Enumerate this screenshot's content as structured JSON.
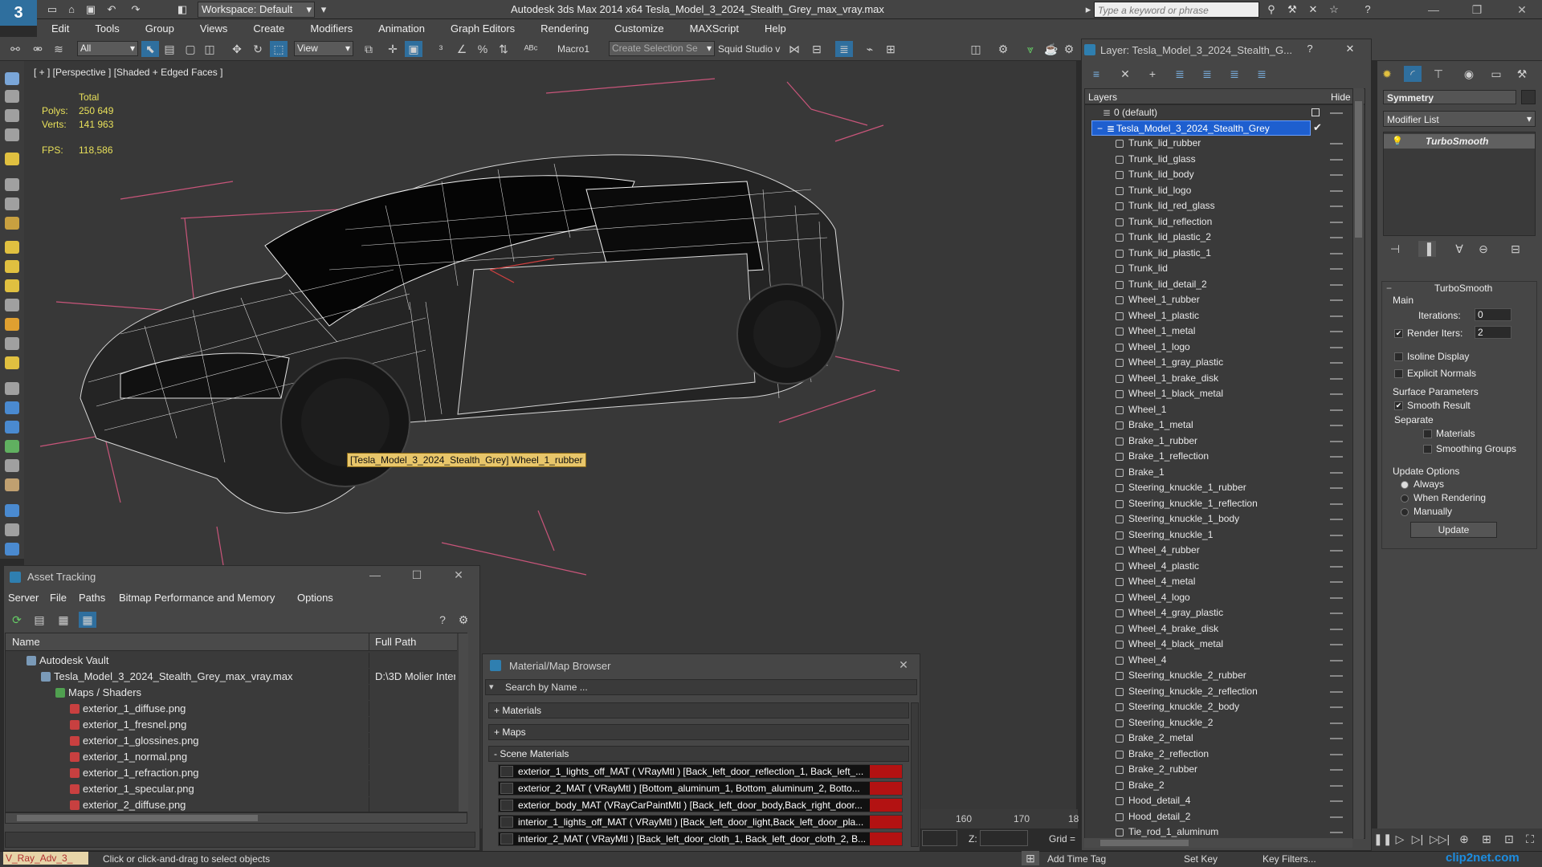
{
  "window": {
    "app_title": "Autodesk 3ds Max  2014 x64     Tesla_Model_3_2024_Stealth_Grey_max_vray.max",
    "workspace": "Workspace: Default",
    "search_placeholder": "Type a keyword or phrase"
  },
  "menu": [
    "Edit",
    "Tools",
    "Group",
    "Views",
    "Create",
    "Modifiers",
    "Animation",
    "Graph Editors",
    "Rendering",
    "Customize",
    "MAXScript",
    "Help"
  ],
  "toolbar": {
    "selection_filter": "All",
    "ref_coord": "View",
    "macro_label": "Macro1",
    "selection_set_placeholder": "Create Selection Se",
    "squid_label": "Squid Studio v"
  },
  "viewport": {
    "label": "[ + ] [Perspective ] [Shaded + Edged Faces ]",
    "stats_total": "Total",
    "polys_label": "Polys:",
    "polys_value": "250 649",
    "verts_label": "Verts:",
    "verts_value": "141 963",
    "fps_label": "FPS:",
    "fps_value": "118,586",
    "tooltip": "[Tesla_Model_3_2024_Stealth_Grey] Wheel_1_rubber",
    "timeline_ticks": [
      "160",
      "170",
      "18"
    ],
    "z_label": "Z:",
    "grid_label": "Grid ="
  },
  "asset_tracking": {
    "title": "Asset Tracking",
    "menu": [
      "Server",
      "File",
      "Paths",
      "Bitmap Performance and Memory",
      "Options"
    ],
    "col_name": "Name",
    "col_path": "Full Path",
    "rows": [
      {
        "name": "Autodesk Vault",
        "path": "",
        "indent": 0
      },
      {
        "name": "Tesla_Model_3_2024_Stealth_Grey_max_vray.max",
        "path": "D:\\3D Molier Inter",
        "indent": 1
      },
      {
        "name": "Maps / Shaders",
        "path": "",
        "indent": 2
      },
      {
        "name": "exterior_1_diffuse.png",
        "path": "",
        "indent": 3
      },
      {
        "name": "exterior_1_fresnel.png",
        "path": "",
        "indent": 3
      },
      {
        "name": "exterior_1_glossines.png",
        "path": "",
        "indent": 3
      },
      {
        "name": "exterior_1_normal.png",
        "path": "",
        "indent": 3
      },
      {
        "name": "exterior_1_refraction.png",
        "path": "",
        "indent": 3
      },
      {
        "name": "exterior_1_specular.png",
        "path": "",
        "indent": 3
      },
      {
        "name": "exterior_2_diffuse.png",
        "path": "",
        "indent": 3
      }
    ]
  },
  "material_browser": {
    "title": "Material/Map Browser",
    "search_placeholder": "Search by Name ...",
    "sections": [
      "+ Materials",
      "+ Maps",
      "- Scene Materials"
    ],
    "scene_materials": [
      "exterior_1_lights_off_MAT ( VRayMtl ) [Back_left_door_reflection_1, Back_left_...",
      "exterior_2_MAT  ( VRayMtl ) [Bottom_aluminum_1, Bottom_aluminum_2, Botto...",
      "exterior_body_MAT (VRayCarPaintMtl ) [Back_left_door_body,Back_right_door...",
      "interior_1_lights_off_MAT ( VRayMtl ) [Back_left_door_light,Back_left_door_pla...",
      "interior_2_MAT  ( VRayMtl ) [Back_left_door_cloth_1, Back_left_door_cloth_2, B..."
    ]
  },
  "layer_explorer": {
    "title": "Layer: Tesla_Model_3_2024_Stealth_G...",
    "col_layers": "Layers",
    "col_hide": "Hide",
    "default_layer": "0 (default)",
    "selected_layer": "Tesla_Model_3_2024_Stealth_Grey",
    "objects": [
      "Trunk_lid_rubber",
      "Trunk_lid_glass",
      "Trunk_lid_body",
      "Trunk_lid_logo",
      "Trunk_lid_red_glass",
      "Trunk_lid_reflection",
      "Trunk_lid_plastic_2",
      "Trunk_lid_plastic_1",
      "Trunk_lid",
      "Trunk_lid_detail_2",
      "Wheel_1_rubber",
      "Wheel_1_plastic",
      "Wheel_1_metal",
      "Wheel_1_logo",
      "Wheel_1_gray_plastic",
      "Wheel_1_brake_disk",
      "Wheel_1_black_metal",
      "Wheel_1",
      "Brake_1_metal",
      "Brake_1_rubber",
      "Brake_1_reflection",
      "Brake_1",
      "Steering_knuckle_1_rubber",
      "Steering_knuckle_1_reflection",
      "Steering_knuckle_1_body",
      "Steering_knuckle_1",
      "Wheel_4_rubber",
      "Wheel_4_plastic",
      "Wheel_4_metal",
      "Wheel_4_logo",
      "Wheel_4_gray_plastic",
      "Wheel_4_brake_disk",
      "Wheel_4_black_metal",
      "Wheel_4",
      "Steering_knuckle_2_rubber",
      "Steering_knuckle_2_reflection",
      "Steering_knuckle_2_body",
      "Steering_knuckle_2",
      "Brake_2_metal",
      "Brake_2_reflection",
      "Brake_2_rubber",
      "Brake_2",
      "Hood_detail_4",
      "Hood_detail_2",
      "Tie_rod_1_aluminum"
    ]
  },
  "command_panel": {
    "object_name": "Symmetry",
    "modifier_list": "Modifier List",
    "stack_item": "TurboSmooth",
    "rollout_title": "TurboSmooth",
    "main_label": "Main",
    "iterations_label": "Iterations:",
    "iterations_value": "0",
    "render_iters_label": "Render Iters:",
    "render_iters_value": "2",
    "isoline": "Isoline Display",
    "explicit_normals": "Explicit Normals",
    "surface_params": "Surface Parameters",
    "smooth_result": "Smooth Result",
    "separate": "Separate",
    "materials": "Materials",
    "smoothing_groups": "Smoothing Groups",
    "update_options": "Update Options",
    "always": "Always",
    "when_rendering": "When Rendering",
    "manually": "Manually",
    "update_button": "Update"
  },
  "status": {
    "script_label": "V_Ray_Adv_3_",
    "hint": "Click or click-and-drag to select objects",
    "add_time_tag": "Add Time Tag",
    "set_key": "Set Key",
    "key_filters": "Key Filters...",
    "watermark": "clip2net.com"
  },
  "colors": {
    "selection_blue": "#1e5fcf",
    "stats_yellow": "#e8e05a",
    "material_red": "#b31212",
    "grid_pink": "#c8557a"
  }
}
